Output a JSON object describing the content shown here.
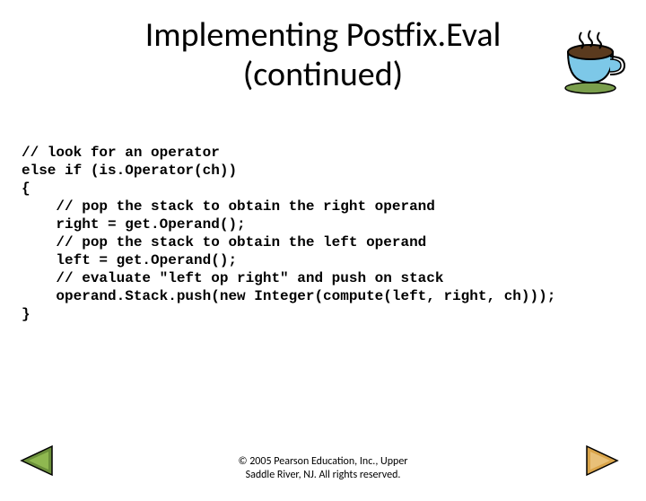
{
  "title": {
    "line1": "Implementing Postfix.Eval",
    "line2": "(continued)"
  },
  "code_lines": [
    "// look for an operator",
    "else if (is.Operator(ch))",
    "{",
    "    // pop the stack to obtain the right operand",
    "    right = get.Operand();",
    "    // pop the stack to obtain the left operand",
    "    left = get.Operand();",
    "    // evaluate \"left op right\" and push on stack",
    "    operand.Stack.push(new Integer(compute(left, right, ch)));",
    "}"
  ],
  "footer": {
    "line1": "© 2005 Pearson Education, Inc., Upper",
    "line2": "Saddle River, NJ. All rights reserved."
  },
  "icons": {
    "cup": "coffee-cup-icon",
    "prev": "prev-arrow-icon",
    "next": "next-arrow-icon"
  }
}
